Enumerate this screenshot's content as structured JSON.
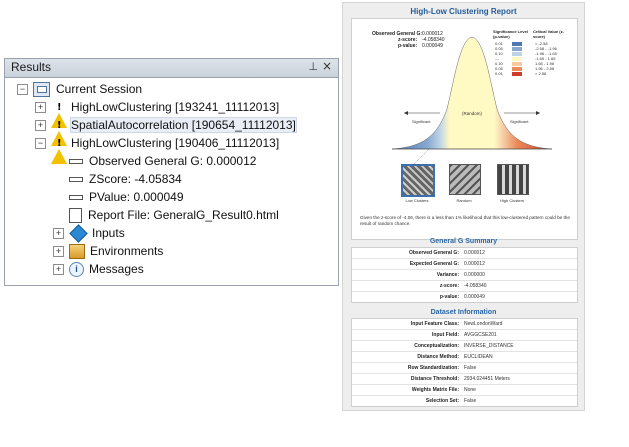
{
  "results": {
    "title": "Results",
    "pin_glyph": "⊥",
    "close_glyph": "×",
    "tree": {
      "session": "Current Session",
      "items": [
        {
          "label": "HighLowClustering [193241_11112013]"
        },
        {
          "label": "SpatialAutocorrelation [190654_11112013]"
        },
        {
          "label": "HighLowClustering [190406_11112013]"
        }
      ],
      "children": {
        "observed": "Observed General G: 0.000012",
        "zscore": "ZScore: -4.05834",
        "pvalue": "PValue: 0.000049",
        "report_file": "Report File: GeneralG_Result0.html",
        "inputs": "Inputs",
        "environments": "Environments",
        "messages": "Messages"
      }
    }
  },
  "report": {
    "title": "High-Low Clustering Report",
    "stats": {
      "observed_label": "Observed General G:",
      "observed_value": "0.000012",
      "zscore_label": "z-score:",
      "zscore_value": "-4.058340",
      "pvalue_label": "p-value:",
      "pvalue_value": "0.000049"
    },
    "legend": {
      "col1": "Significance Level (p-value)",
      "col2": "Critical Value (z-score)",
      "rows": [
        {
          "p": "0.01",
          "z": "< -2.58",
          "color": "#4f78b3"
        },
        {
          "p": "0.05",
          "z": "-2.58 - -1.96",
          "color": "#86a8cf"
        },
        {
          "p": "0.10",
          "z": "-1.96 - -1.65",
          "color": "#bfd3e6"
        },
        {
          "p": "---",
          "z": "-1.65 - 1.65",
          "color": "#fff9c4"
        },
        {
          "p": "0.10",
          "z": "1.65 - 1.96",
          "color": "#f6c9a2"
        },
        {
          "p": "0.05",
          "z": "1.96 - 2.58",
          "color": "#ec8a5a"
        },
        {
          "p": "0.01",
          "z": "> 2.58",
          "color": "#cf3b2a"
        }
      ]
    },
    "curve_labels": {
      "random": "(Random)",
      "significant_left": "Significant",
      "significant_right": "Significant"
    },
    "thumbs": {
      "low": "Low Clusters",
      "random": "Random",
      "high": "High Clusters"
    },
    "caption": "Given the z-score of -4.06, there is a less than 1% likelihood that this low-clustered pattern could be the result of random chance.",
    "summary": {
      "heading": "General G Summary",
      "rows": [
        {
          "k": "Observed General G:",
          "v": "0.000012"
        },
        {
          "k": "Expected General G:",
          "v": "0.000012"
        },
        {
          "k": "Variance:",
          "v": "0.000000"
        },
        {
          "k": "z-score:",
          "v": "-4.058340"
        },
        {
          "k": "p-value:",
          "v": "0.000049"
        }
      ]
    },
    "dataset": {
      "heading": "Dataset Information",
      "rows": [
        {
          "k": "Input Feature Class:",
          "v": "NewLondonWard"
        },
        {
          "k": "Input Field:",
          "v": "AVGGCSE201"
        },
        {
          "k": "Conceptualization:",
          "v": "INVERSE_DISTANCE"
        },
        {
          "k": "Distance Method:",
          "v": "EUCLIDEAN"
        },
        {
          "k": "Row Standardization:",
          "v": "False"
        },
        {
          "k": "Distance Threshold:",
          "v": "2934.024451 Meters"
        },
        {
          "k": "Weights Matrix File:",
          "v": "None"
        },
        {
          "k": "Selection Set:",
          "v": "False"
        }
      ]
    }
  }
}
